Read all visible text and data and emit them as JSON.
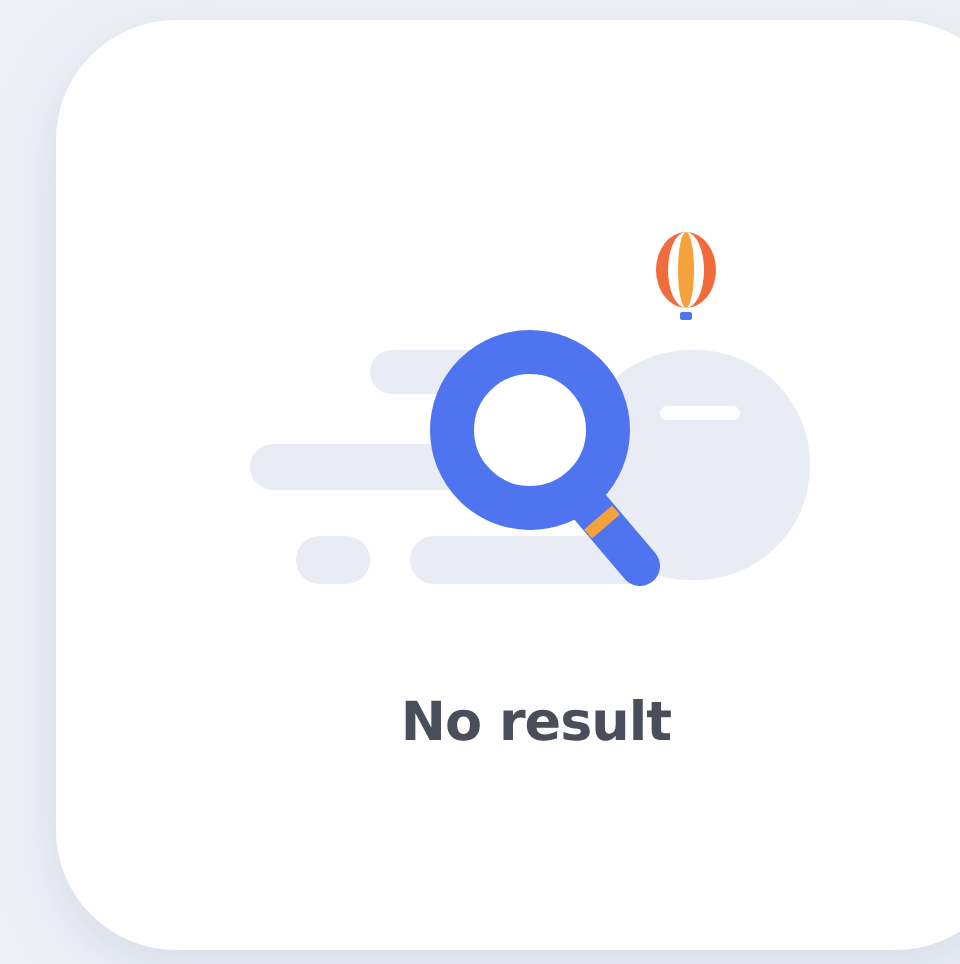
{
  "message": "No result"
}
